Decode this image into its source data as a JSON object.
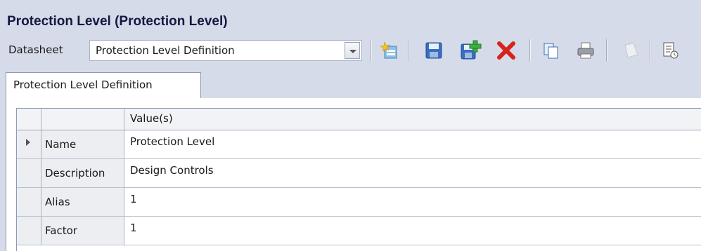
{
  "window": {
    "title": "Protection Level (Protection Level)"
  },
  "toolbar": {
    "datasheet_label": "Datasheet",
    "datasheet_value": "Protection Level Definition",
    "icons": [
      "new-record-icon",
      "save-icon",
      "save-and-new-icon",
      "delete-icon",
      "copy-icon",
      "print-icon",
      "disabled-icon",
      "properties-icon"
    ]
  },
  "tabs": [
    {
      "label": "Protection Level Definition"
    }
  ],
  "grid": {
    "header": "Value(s)",
    "rows": [
      {
        "label": "Name",
        "value": "Protection Level"
      },
      {
        "label": "Description",
        "value": "Design Controls"
      },
      {
        "label": "Alias",
        "value": "1"
      },
      {
        "label": "Factor",
        "value": "1"
      }
    ]
  }
}
